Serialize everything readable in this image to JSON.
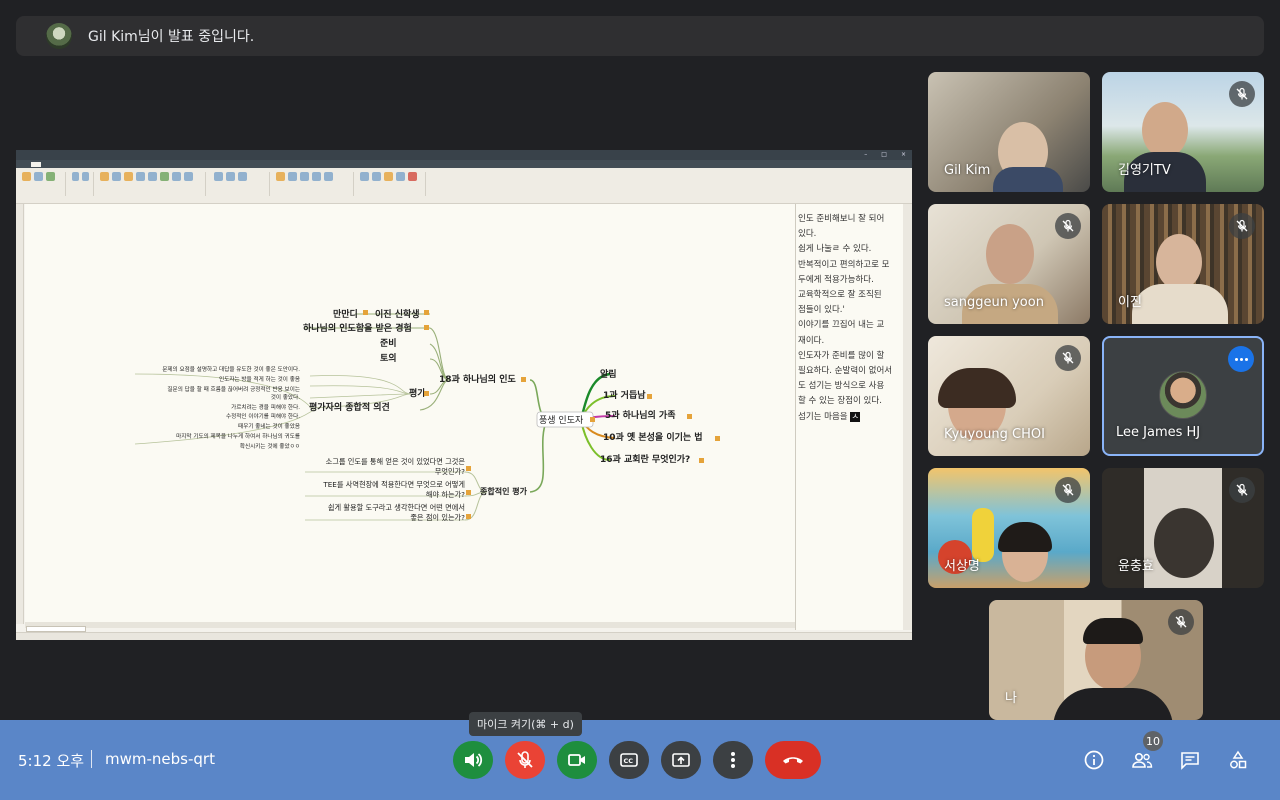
{
  "banner": {
    "presenter_text": "Gil Kim님이 발표 중입니다."
  },
  "mindmap": {
    "center": "풍생 인도자",
    "right_nodes": [
      "알림",
      "1과 거듭남",
      "5과 하나님의 가족",
      "10과 옛 본성을 이기는 법",
      "16과 교회란 무엇인가?"
    ],
    "topic18": "18과 하나님의 인도",
    "t18_children": [
      "만만디",
      "이진 신학생",
      "하나님의 인도함을 받은 경험",
      "준비",
      "토의",
      "평가",
      "평가자의 종합적 의견"
    ],
    "eval_details": [
      "문제의 요점을 설명하고 대답을 유도한 것이 좋은 도안이다.",
      "인도자는 방을 적게 하는 것이 좋음",
      "질문의 답을 할 때 흐름을 끊어버려 긍정적인 반응 보이는",
      "것이 좋았다.",
      "가르치려는 경을 피해야 한다.",
      "수정적인 이야기를 피해야 한다.",
      "때우기 좋네는 것이 좋았음",
      "마지막 기도의 제목을 나누게 하여서 하나님의 귀도를",
      "확신시키는 것에 좋았ㅇㅇ"
    ],
    "summary": "종합적인 평가",
    "summary_children": [
      "소그룹 인도를 통해 얻은 것이 있었다면 그것은",
      "무엇인가?",
      "TEE를 사역현장에 적용한다면 무엇으로 어떻게",
      "해야 하는가?",
      "쉽게 활용할 도구라고 생각한다면 어떤 면에서",
      "좋은 점이 있는가?"
    ]
  },
  "notes": {
    "lines": [
      "인도 준비해보니 잘 되어",
      "있다.",
      "쉽게 나눌ㄹ 수 있다.",
      "반복적이고 편의하고로 모",
      "두에게 적용가능하다.",
      "",
      "교육학적으로 잘 조직된",
      "점들이 있다.'",
      "이야기를 끄집어 내는 교",
      "재이다.",
      "인도자가 준비를 많이 할",
      "필요하다. 순발력이 없어서",
      "도 섬기는 방식으로 사용",
      "할 수 있는 장점이 있다.",
      "",
      "섬기는 마음을"
    ],
    "cursor_char": "ㅅ"
  },
  "participants": [
    {
      "name": "Gil Kim",
      "muted": false
    },
    {
      "name": "김영기TV",
      "muted": true
    },
    {
      "name": "sanggeun yoon",
      "muted": true
    },
    {
      "name": "이진",
      "muted": true
    },
    {
      "name": "Kyuyoung CHOI",
      "muted": true
    },
    {
      "name": "Lee James HJ",
      "muted": false
    },
    {
      "name": "서상명",
      "muted": true
    },
    {
      "name": "윤충효",
      "muted": true
    },
    {
      "name": "나",
      "muted": true
    }
  ],
  "bottom": {
    "time": "5:12 오후",
    "meeting_code": "mwm-nebs-qrt",
    "mic_tooltip": "마이크 켜기(⌘ + d)",
    "people_count": "10"
  },
  "colors": {
    "bar": "#5a86c8",
    "green": "#1e8e3e",
    "red": "#ea4335",
    "end": "#d93025"
  }
}
